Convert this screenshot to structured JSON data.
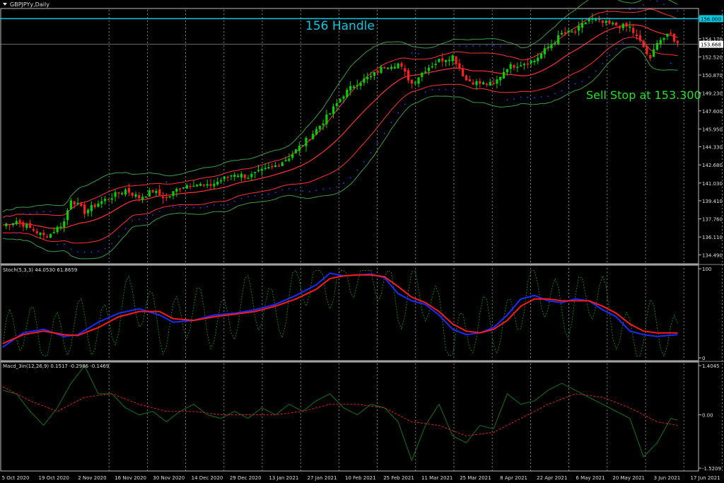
{
  "window_title": "GBPJPYy,Daily",
  "price_panel": {
    "annotations": {
      "handle": "156 Handle",
      "sell_stop": "Sell Stop at 153.300"
    },
    "ticks": [
      "156.080",
      "154.170",
      "152.520",
      "150.870",
      "149.230",
      "147.600",
      "145.950",
      "144.330",
      "142.680",
      "141.030",
      "139.410",
      "137.760",
      "136.110",
      "134.490"
    ],
    "current_price_label": "153.668",
    "handle_level_label": "156.000",
    "colors": {
      "up": "#00d000",
      "down": "#ff2020",
      "handle": "#00c8e0",
      "band_outer": "#3a9a4a",
      "band_mid": "#ff3030",
      "sar": "#2040ff"
    }
  },
  "stoch_panel": {
    "title": "Stoch(5,3,3) 44.0530 61.8659",
    "ticks": [
      "100",
      "0"
    ],
    "colors": {
      "main": "#1a2cff",
      "signal": "#ff1a1a",
      "raw": "#0f7a1a"
    }
  },
  "macd_panel": {
    "title": "Macd_3in(12,26,9) 0.1517 -0.2986 -0.1469",
    "ticks": [
      "1.4045",
      "0.00",
      "-1.5209"
    ],
    "colors": {
      "line": "#106018",
      "signal": "#d02020"
    }
  },
  "dates": [
    "5 Oct 2020",
    "19 Oct 2020",
    "2 Nov 2020",
    "16 Nov 2020",
    "30 Nov 2020",
    "14 Dec 2020",
    "29 Dec 2020",
    "13 Jan 2021",
    "27 Jan 2021",
    "10 Feb 2021",
    "25 Feb 2021",
    "11 Mar 2021",
    "25 Mar 2021",
    "8 Apr 2021",
    "22 Apr 2021",
    "6 May 2021",
    "20 May 2021",
    "3 Jun 2021",
    "17 Jun 2021"
  ],
  "chart_data": [
    {
      "type": "candlestick",
      "title": "GBPJPYy,Daily",
      "ylim": [
        133.8,
        156.8
      ],
      "lines": {
        "handle": 156.0,
        "current": 153.668
      },
      "close_anchors": [
        [
          0,
          137.2
        ],
        [
          4,
          137.6
        ],
        [
          8,
          136.9
        ],
        [
          12,
          136.2
        ],
        [
          14,
          136.4
        ],
        [
          18,
          137.5
        ],
        [
          20,
          139.6
        ],
        [
          24,
          138.4
        ],
        [
          28,
          139.2
        ],
        [
          32,
          139.8
        ],
        [
          36,
          140.4
        ],
        [
          40,
          139.7
        ],
        [
          44,
          140.3
        ],
        [
          48,
          139.6
        ],
        [
          52,
          140.7
        ],
        [
          56,
          141.0
        ],
        [
          60,
          140.7
        ],
        [
          64,
          141.3
        ],
        [
          68,
          141.9
        ],
        [
          72,
          141.6
        ],
        [
          76,
          142.1
        ],
        [
          80,
          142.6
        ],
        [
          84,
          143.4
        ],
        [
          88,
          144.6
        ],
        [
          92,
          145.9
        ],
        [
          96,
          147.4
        ],
        [
          100,
          149.1
        ],
        [
          104,
          150.2
        ],
        [
          108,
          150.7
        ],
        [
          112,
          151.7
        ],
        [
          116,
          151.9
        ],
        [
          120,
          150.1
        ],
        [
          124,
          151.4
        ],
        [
          128,
          152.2
        ],
        [
          132,
          152.6
        ],
        [
          136,
          150.4
        ],
        [
          140,
          150.1
        ],
        [
          144,
          150.0
        ],
        [
          148,
          151.6
        ],
        [
          152,
          151.9
        ],
        [
          156,
          152.2
        ],
        [
          160,
          153.4
        ],
        [
          164,
          154.6
        ],
        [
          168,
          154.8
        ],
        [
          172,
          156.0
        ],
        [
          176,
          155.6
        ],
        [
          180,
          155.4
        ],
        [
          184,
          155.2
        ],
        [
          188,
          153.4
        ],
        [
          190,
          152.2
        ],
        [
          192,
          154.0
        ],
        [
          196,
          154.5
        ],
        [
          198,
          153.7
        ]
      ]
    },
    {
      "type": "line",
      "title": "Stoch(5,3,3) 44.0530 61.8659",
      "ylim": [
        0,
        100
      ],
      "series": [
        {
          "values": [
            [
              0,
              12
            ],
            [
              6,
              28
            ],
            [
              12,
              32
            ],
            [
              18,
              24
            ],
            [
              22,
              26
            ],
            [
              28,
              40
            ],
            [
              34,
              50
            ],
            [
              40,
              55
            ],
            [
              46,
              48
            ],
            [
              50,
              40
            ],
            [
              56,
              42
            ],
            [
              62,
              48
            ],
            [
              68,
              50
            ],
            [
              74,
              54
            ],
            [
              80,
              60
            ],
            [
              86,
              70
            ],
            [
              92,
              82
            ],
            [
              96,
              95
            ],
            [
              100,
              92
            ],
            [
              104,
              93
            ],
            [
              108,
              94
            ],
            [
              112,
              90
            ],
            [
              116,
              72
            ],
            [
              120,
              64
            ],
            [
              124,
              60
            ],
            [
              128,
              48
            ],
            [
              132,
              32
            ],
            [
              136,
              26
            ],
            [
              140,
              28
            ],
            [
              144,
              34
            ],
            [
              148,
              48
            ],
            [
              152,
              66
            ],
            [
              156,
              70
            ],
            [
              160,
              64
            ],
            [
              164,
              62
            ],
            [
              168,
              66
            ],
            [
              172,
              64
            ],
            [
              176,
              54
            ],
            [
              180,
              46
            ],
            [
              184,
              30
            ],
            [
              188,
              26
            ],
            [
              192,
              24
            ],
            [
              198,
              26
            ]
          ]
        },
        {
          "values": [
            [
              0,
              16
            ],
            [
              6,
              26
            ],
            [
              12,
              30
            ],
            [
              18,
              26
            ],
            [
              22,
              25
            ],
            [
              28,
              34
            ],
            [
              34,
              46
            ],
            [
              40,
              52
            ],
            [
              46,
              52
            ],
            [
              50,
              44
            ],
            [
              56,
              42
            ],
            [
              62,
              46
            ],
            [
              68,
              49
            ],
            [
              74,
              52
            ],
            [
              80,
              58
            ],
            [
              86,
              66
            ],
            [
              92,
              77
            ],
            [
              96,
              89
            ],
            [
              100,
              92
            ],
            [
              104,
              93
            ],
            [
              108,
              93
            ],
            [
              112,
              91
            ],
            [
              116,
              80
            ],
            [
              120,
              68
            ],
            [
              124,
              62
            ],
            [
              128,
              52
            ],
            [
              132,
              38
            ],
            [
              136,
              30
            ],
            [
              140,
              28
            ],
            [
              144,
              32
            ],
            [
              148,
              42
            ],
            [
              152,
              58
            ],
            [
              156,
              66
            ],
            [
              160,
              66
            ],
            [
              164,
              64
            ],
            [
              168,
              64
            ],
            [
              172,
              64
            ],
            [
              176,
              58
            ],
            [
              180,
              50
            ],
            [
              184,
              38
            ],
            [
              188,
              30
            ],
            [
              192,
              28
            ],
            [
              198,
              28
            ]
          ]
        }
      ]
    },
    {
      "type": "line",
      "title": "Macd_3in(12,26,9) 0.1517 -0.2986 -0.1469",
      "ylim": [
        -1.5209,
        1.4045
      ],
      "series": [
        {
          "values": [
            [
              0,
              0.7
            ],
            [
              4,
              0.6
            ],
            [
              8,
              0.1
            ],
            [
              12,
              -0.3
            ],
            [
              16,
              0.2
            ],
            [
              20,
              0.9
            ],
            [
              24,
              1.4
            ],
            [
              28,
              0.6
            ],
            [
              32,
              0.6
            ],
            [
              36,
              0.2
            ],
            [
              40,
              0.0
            ],
            [
              44,
              0.1
            ],
            [
              48,
              -0.2
            ],
            [
              52,
              0.1
            ],
            [
              56,
              0.3
            ],
            [
              60,
              0.0
            ],
            [
              64,
              -0.1
            ],
            [
              68,
              0.1
            ],
            [
              72,
              -0.1
            ],
            [
              76,
              0.2
            ],
            [
              80,
              0.0
            ],
            [
              84,
              0.3
            ],
            [
              88,
              0.1
            ],
            [
              92,
              0.4
            ],
            [
              96,
              0.6
            ],
            [
              100,
              0.2
            ],
            [
              104,
              0.0
            ],
            [
              108,
              0.3
            ],
            [
              112,
              0.2
            ],
            [
              116,
              -0.2
            ],
            [
              120,
              -1.3
            ],
            [
              124,
              -0.3
            ],
            [
              128,
              0.3
            ],
            [
              132,
              -0.6
            ],
            [
              136,
              -0.8
            ],
            [
              140,
              -0.3
            ],
            [
              144,
              -0.4
            ],
            [
              148,
              0.6
            ],
            [
              152,
              0.3
            ],
            [
              156,
              0.4
            ],
            [
              160,
              0.7
            ],
            [
              164,
              0.9
            ],
            [
              168,
              0.7
            ],
            [
              172,
              0.5
            ],
            [
              176,
              0.3
            ],
            [
              180,
              0.1
            ],
            [
              184,
              -0.1
            ],
            [
              188,
              -1.2
            ],
            [
              192,
              -0.8
            ],
            [
              196,
              -0.1
            ],
            [
              198,
              -0.15
            ]
          ]
        },
        {
          "values": [
            [
              0,
              0.8
            ],
            [
              8,
              0.4
            ],
            [
              16,
              0.1
            ],
            [
              24,
              0.5
            ],
            [
              32,
              0.6
            ],
            [
              40,
              0.3
            ],
            [
              48,
              0.1
            ],
            [
              56,
              0.1
            ],
            [
              64,
              0.0
            ],
            [
              72,
              0.0
            ],
            [
              80,
              0.0
            ],
            [
              88,
              0.1
            ],
            [
              96,
              0.3
            ],
            [
              104,
              0.3
            ],
            [
              112,
              0.2
            ],
            [
              120,
              -0.2
            ],
            [
              128,
              -0.3
            ],
            [
              136,
              -0.6
            ],
            [
              144,
              -0.5
            ],
            [
              152,
              -0.1
            ],
            [
              160,
              0.3
            ],
            [
              168,
              0.6
            ],
            [
              176,
              0.5
            ],
            [
              184,
              0.2
            ],
            [
              192,
              -0.2
            ],
            [
              198,
              -0.3
            ]
          ]
        }
      ]
    }
  ]
}
